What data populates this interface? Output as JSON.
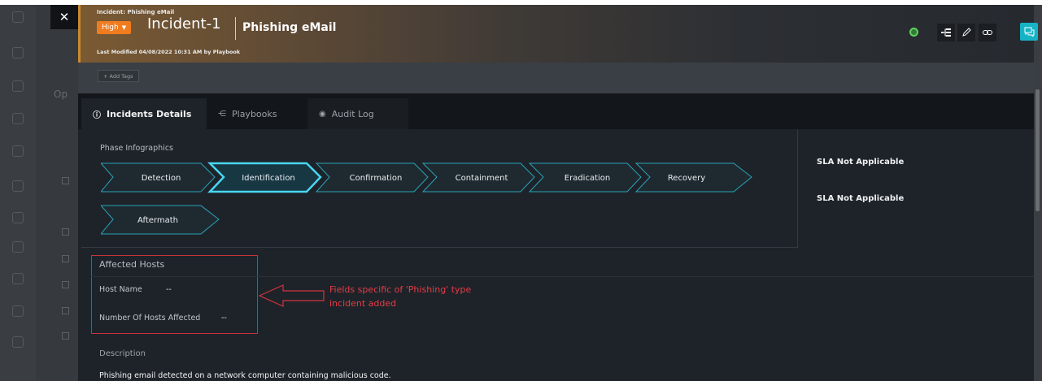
{
  "background": {
    "panel_text": "Op"
  },
  "modal": {
    "close_glyph": "✕",
    "kicker": "Incident: Phishing eMail",
    "severity": "High",
    "incident_id": "Incident-1",
    "incident_name": "Phishing eMail",
    "last_modified": "Last Modified 04/08/2022 10:31 AM by Playbook",
    "add_tags": "+ Add Tags",
    "accent_color": "#c98a2e",
    "severity_color": "#f07c1f",
    "tabs": [
      {
        "label": "Incidents Details",
        "icon": "info-icon",
        "glyph": "ⓘ"
      },
      {
        "label": "Playbooks",
        "icon": "playbook-icon",
        "glyph": "⋲"
      },
      {
        "label": "Audit Log",
        "icon": "eye-icon",
        "glyph": "◉"
      }
    ],
    "phase_title": "Phase Infographics",
    "phases": [
      "Detection",
      "Identification",
      "Confirmation",
      "Containment",
      "Eradication",
      "Recovery",
      "Aftermath"
    ],
    "active_phase": "Identification",
    "sla": [
      "SLA Not Applicable",
      "SLA Not Applicable"
    ],
    "affected_hosts": {
      "heading": "Affected Hosts",
      "host_name_label": "Host Name",
      "host_name_value": "--",
      "num_hosts_label": "Number Of Hosts Affected",
      "num_hosts_value": "--"
    },
    "annotation": "Fields specific of 'Phishing' type incident added",
    "description_heading": "Description",
    "description": "Phishing email detected on a network computer containing malicious code."
  }
}
